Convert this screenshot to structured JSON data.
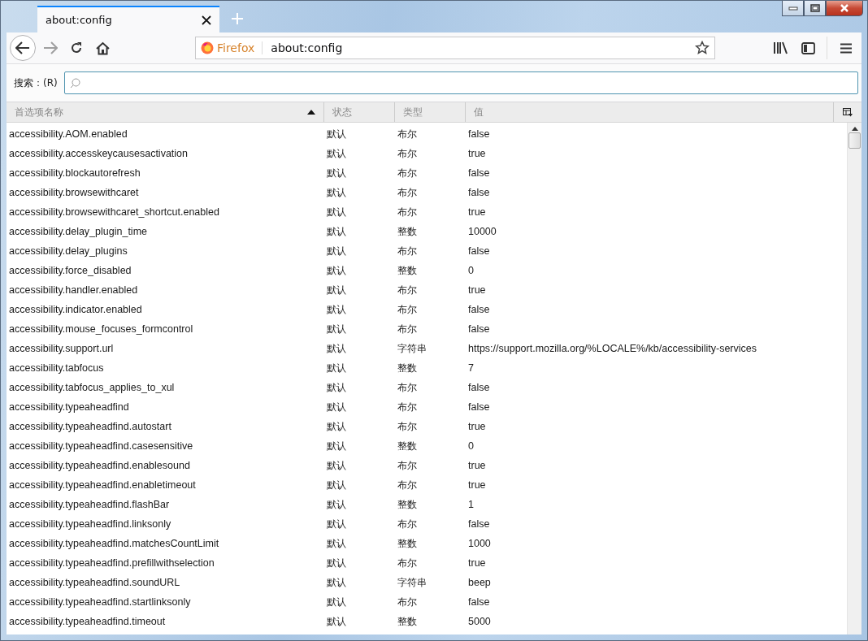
{
  "tab": {
    "title": "about:config"
  },
  "url_bar": {
    "identity": "Firefox",
    "url": "about:config"
  },
  "search": {
    "label": "搜索：(R)"
  },
  "table": {
    "columns": [
      {
        "label": "首选项名称",
        "sorted": true
      },
      {
        "label": "状态",
        "sorted": false
      },
      {
        "label": "类型",
        "sorted": false
      },
      {
        "label": "值",
        "sorted": false
      }
    ],
    "rows": [
      {
        "name": "accessibility.AOM.enabled",
        "status": "默认",
        "type": "布尔",
        "value": "false"
      },
      {
        "name": "accessibility.accesskeycausesactivation",
        "status": "默认",
        "type": "布尔",
        "value": "true"
      },
      {
        "name": "accessibility.blockautorefresh",
        "status": "默认",
        "type": "布尔",
        "value": "false"
      },
      {
        "name": "accessibility.browsewithcaret",
        "status": "默认",
        "type": "布尔",
        "value": "false"
      },
      {
        "name": "accessibility.browsewithcaret_shortcut.enabled",
        "status": "默认",
        "type": "布尔",
        "value": "true"
      },
      {
        "name": "accessibility.delay_plugin_time",
        "status": "默认",
        "type": "整数",
        "value": "10000"
      },
      {
        "name": "accessibility.delay_plugins",
        "status": "默认",
        "type": "布尔",
        "value": "false"
      },
      {
        "name": "accessibility.force_disabled",
        "status": "默认",
        "type": "整数",
        "value": "0"
      },
      {
        "name": "accessibility.handler.enabled",
        "status": "默认",
        "type": "布尔",
        "value": "true"
      },
      {
        "name": "accessibility.indicator.enabled",
        "status": "默认",
        "type": "布尔",
        "value": "false"
      },
      {
        "name": "accessibility.mouse_focuses_formcontrol",
        "status": "默认",
        "type": "布尔",
        "value": "false"
      },
      {
        "name": "accessibility.support.url",
        "status": "默认",
        "type": "字符串",
        "value": "https://support.mozilla.org/%LOCALE%/kb/accessibility-services"
      },
      {
        "name": "accessibility.tabfocus",
        "status": "默认",
        "type": "整数",
        "value": "7"
      },
      {
        "name": "accessibility.tabfocus_applies_to_xul",
        "status": "默认",
        "type": "布尔",
        "value": "false"
      },
      {
        "name": "accessibility.typeaheadfind",
        "status": "默认",
        "type": "布尔",
        "value": "false"
      },
      {
        "name": "accessibility.typeaheadfind.autostart",
        "status": "默认",
        "type": "布尔",
        "value": "true"
      },
      {
        "name": "accessibility.typeaheadfind.casesensitive",
        "status": "默认",
        "type": "整数",
        "value": "0"
      },
      {
        "name": "accessibility.typeaheadfind.enablesound",
        "status": "默认",
        "type": "布尔",
        "value": "true"
      },
      {
        "name": "accessibility.typeaheadfind.enabletimeout",
        "status": "默认",
        "type": "布尔",
        "value": "true"
      },
      {
        "name": "accessibility.typeaheadfind.flashBar",
        "status": "默认",
        "type": "整数",
        "value": "1"
      },
      {
        "name": "accessibility.typeaheadfind.linksonly",
        "status": "默认",
        "type": "布尔",
        "value": "false"
      },
      {
        "name": "accessibility.typeaheadfind.matchesCountLimit",
        "status": "默认",
        "type": "整数",
        "value": "1000"
      },
      {
        "name": "accessibility.typeaheadfind.prefillwithselection",
        "status": "默认",
        "type": "布尔",
        "value": "true"
      },
      {
        "name": "accessibility.typeaheadfind.soundURL",
        "status": "默认",
        "type": "字符串",
        "value": "beep"
      },
      {
        "name": "accessibility.typeaheadfind.startlinksonly",
        "status": "默认",
        "type": "布尔",
        "value": "false"
      },
      {
        "name": "accessibility.typeaheadfind.timeout",
        "status": "默认",
        "type": "整数",
        "value": "5000"
      }
    ]
  }
}
